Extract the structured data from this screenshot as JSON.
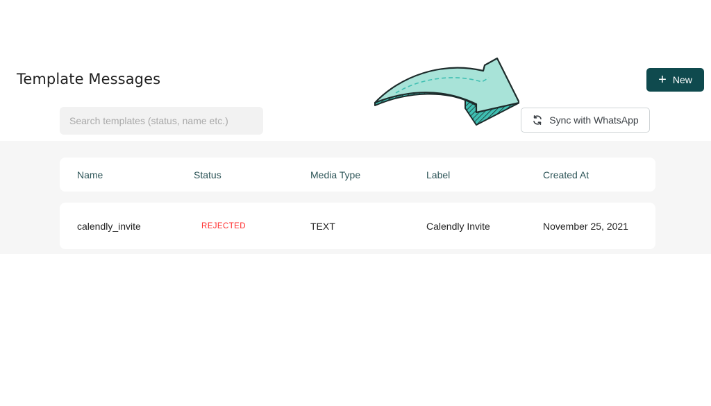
{
  "header": {
    "title": "Template Messages",
    "new_button_label": "New"
  },
  "search": {
    "placeholder": "Search templates (status, name etc.)",
    "value": ""
  },
  "sync": {
    "label": "Sync with WhatsApp"
  },
  "table": {
    "columns": [
      "Name",
      "Status",
      "Media Type",
      "Label",
      "Created At"
    ],
    "rows": [
      {
        "name": "calendly_invite",
        "status": "REJECTED",
        "media_type": "TEXT",
        "label": "Calendly Invite",
        "created_at": "November 25, 2021"
      }
    ]
  },
  "colors": {
    "primary": "#0f4a4e",
    "status_rejected": "#ff2b2b",
    "arrow_fill": "#a8e3d8",
    "arrow_side": "#3fbfb2",
    "table_bg": "#f6f6f6"
  },
  "icons": {
    "new": "plus-icon",
    "sync": "sync-icon",
    "annotation": "curved-arrow-icon"
  }
}
